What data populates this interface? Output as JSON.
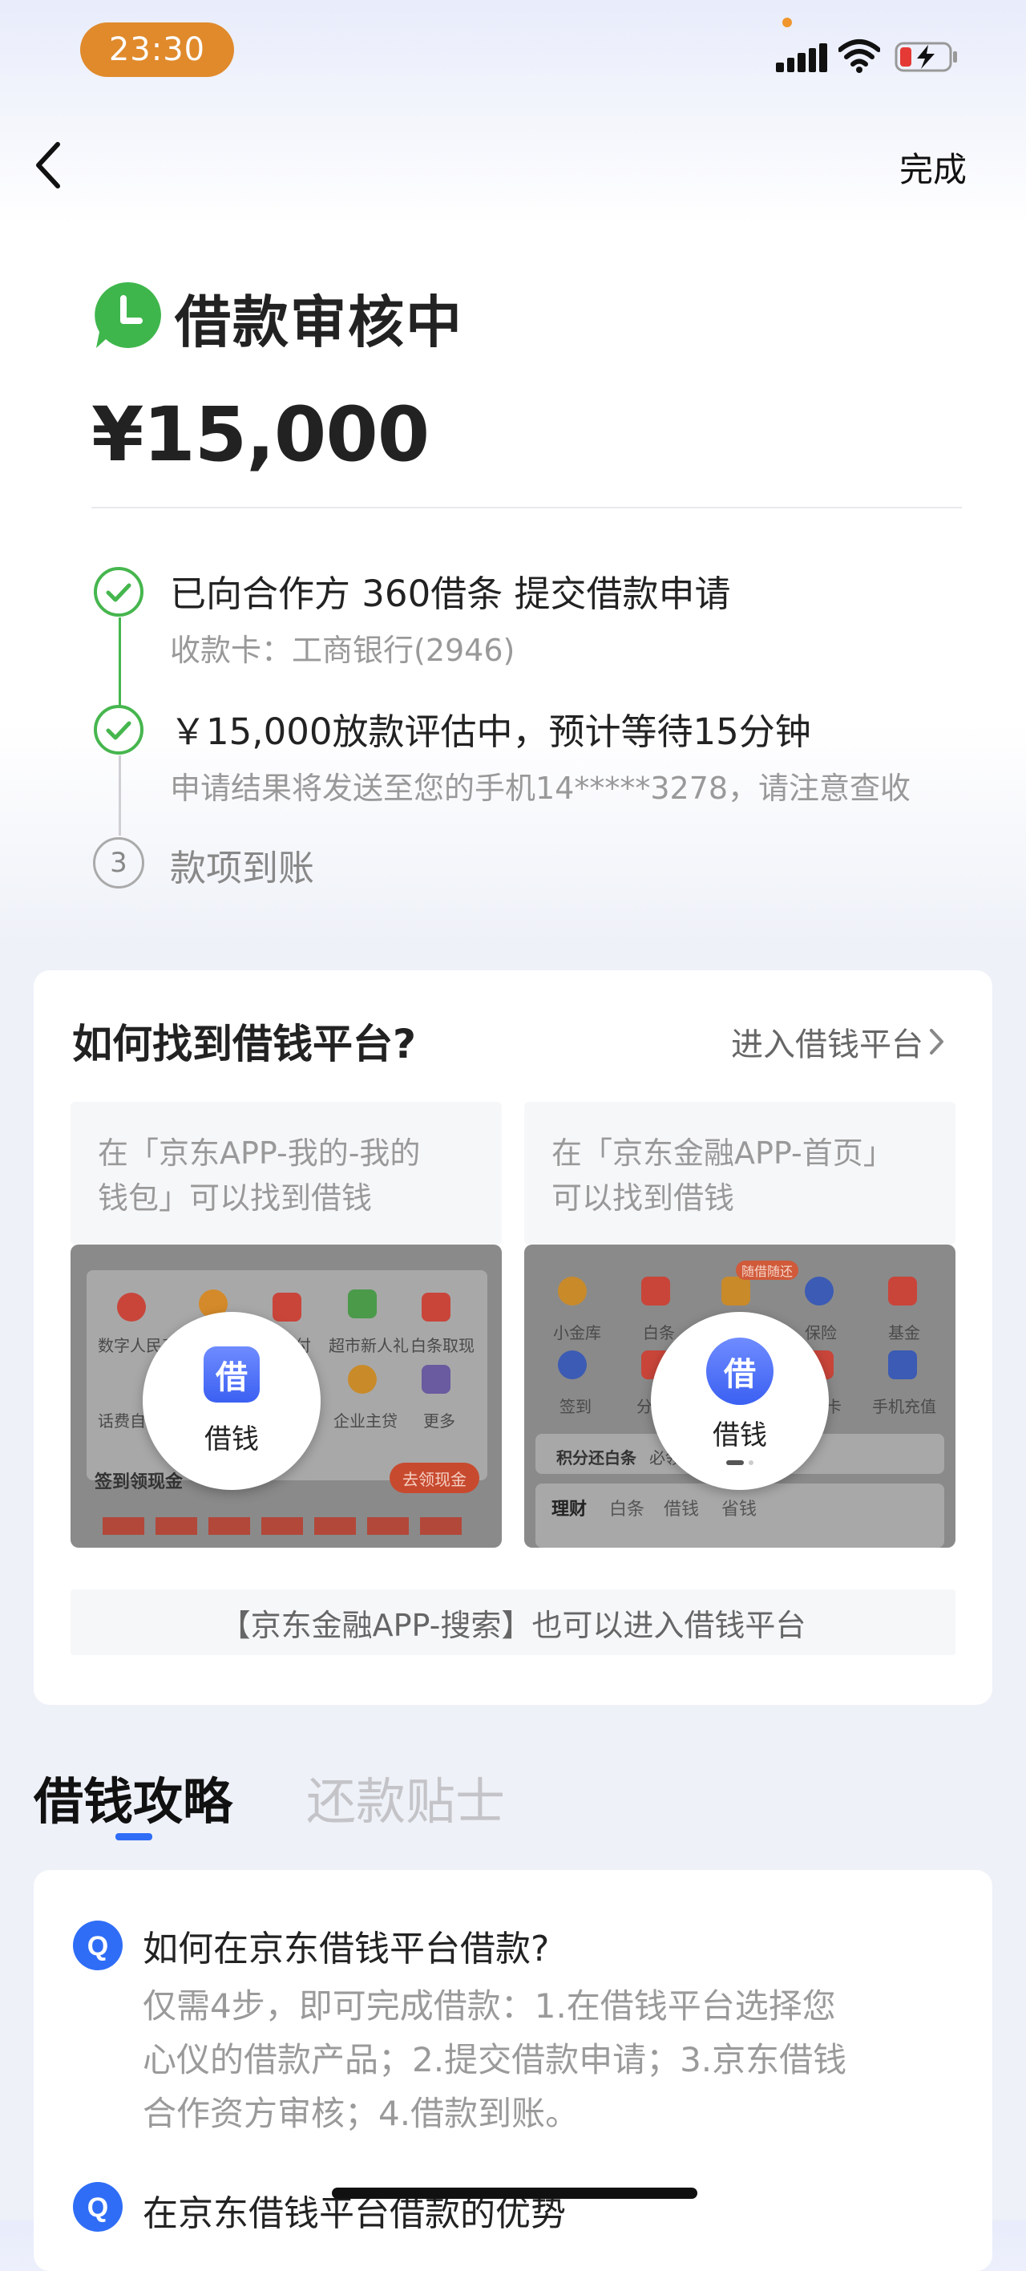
{
  "status_bar": {
    "time": "23:30"
  },
  "nav": {
    "done_label": "完成"
  },
  "status": {
    "title": "借款审核中",
    "amount": "¥15,000"
  },
  "timeline": {
    "steps": [
      {
        "title": "已向合作方 360借条 提交借款申请",
        "sub": "收款卡：工商银行(2946)",
        "state": "done"
      },
      {
        "title": "￥15,000放款评估中，预计等待15分钟",
        "sub": "申请结果将发送至您的手机14*****3278，请注意查收",
        "state": "done"
      },
      {
        "num": "3",
        "title": "款项到账",
        "state": "pending"
      }
    ]
  },
  "platform_card": {
    "title": "如何找到借钱平台?",
    "link_label": "进入借钱平台",
    "left_panel": {
      "caption_line1": "在「京东APP-我的-我的",
      "caption_line2": "钱包」可以找到借钱",
      "bubble_icon": "借",
      "bubble_label": "借钱",
      "mini_labels": [
        "数字人民币",
        "付",
        "超市新人礼",
        "白条取现",
        "话费自",
        "企业主贷",
        "更多"
      ],
      "footer_label": "签到领现金",
      "footer_button": "去领现金"
    },
    "right_panel": {
      "caption_line1": "在「京东金融APP-首页」",
      "caption_line2": "可以找到借钱",
      "bubble_icon": "借",
      "bubble_label": "借钱",
      "mini_labels": [
        "小金库",
        "白条",
        "保险",
        "基金",
        "签到",
        "分",
        "卡",
        "手机充值"
      ],
      "mini_badge": "随借随还",
      "bar_label": "积分还白条",
      "bar_extra": "必领",
      "tabs": [
        "理财",
        "白条",
        "借钱",
        "省钱"
      ]
    },
    "search_tip": "【京东金融APP-搜索】也可以进入借钱平台"
  },
  "tabs": {
    "active": "借钱攻略",
    "inactive": "还款贴士"
  },
  "faq": {
    "items": [
      {
        "q": "如何在京东借钱平台借款?",
        "a_line1": "仅需4步，即可完成借款：1.在借钱平台选择您",
        "a_line2": "心仪的借款产品；2.提交借款申请；3.京东借钱",
        "a_line3": "合作资方审核；4.借款到账。"
      },
      {
        "q": "在京东借钱平台借款的优势"
      }
    ]
  },
  "colors": {
    "accent": "#2f6df6",
    "success": "#46b64e",
    "badge": "#e08a2c"
  }
}
